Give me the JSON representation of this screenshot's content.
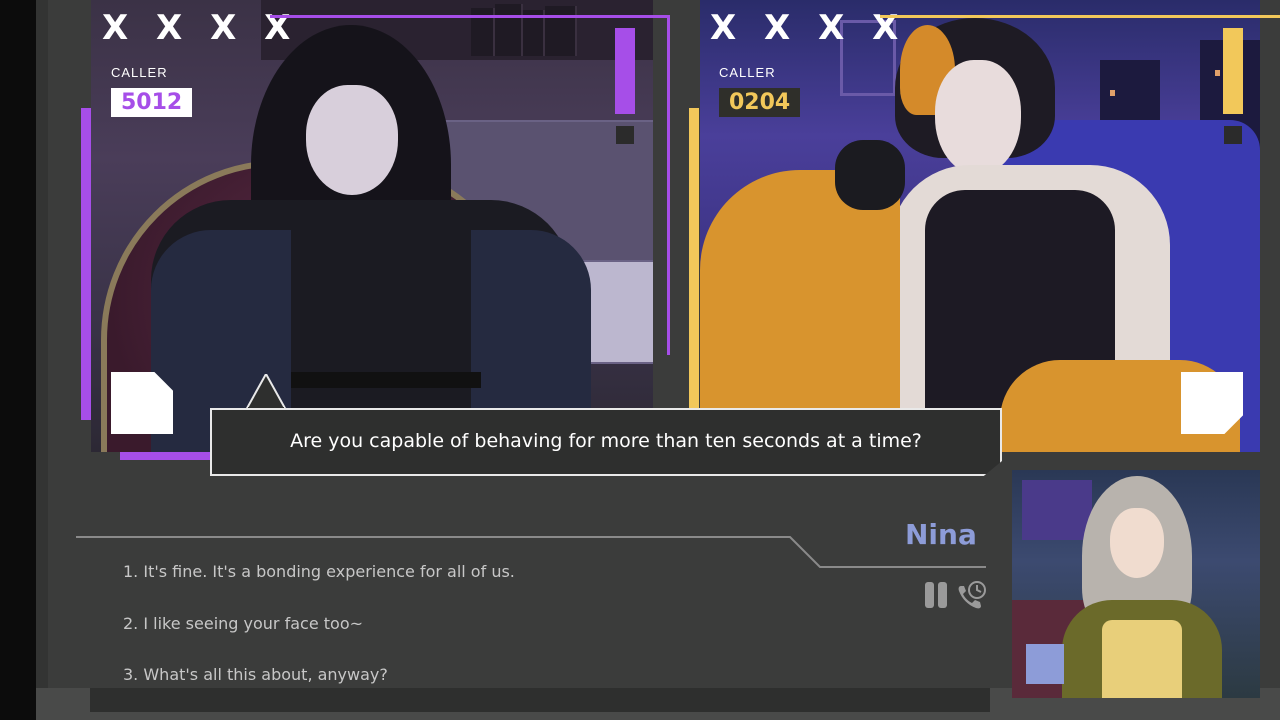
{
  "callers": [
    {
      "marks": "XXXX",
      "label": "CALLER",
      "number": "5012",
      "accent": "#a64ee8"
    },
    {
      "marks": "XXXX",
      "label": "CALLER",
      "number": "0204",
      "accent": "#f2c85a"
    }
  ],
  "dialogue": {
    "line": "Are you capable of behaving for more than ten seconds at a time?"
  },
  "speaker": {
    "name": "Nina",
    "accent": "#8d9cd8"
  },
  "choices": [
    {
      "label": "1. It's fine. It's a bonding experience for all of us."
    },
    {
      "label": "2. I like seeing your face too~"
    },
    {
      "label": "3. What's all this about, anyway?"
    }
  ],
  "icons": {
    "pause": "pause-icon",
    "call": "call-history-icon"
  }
}
